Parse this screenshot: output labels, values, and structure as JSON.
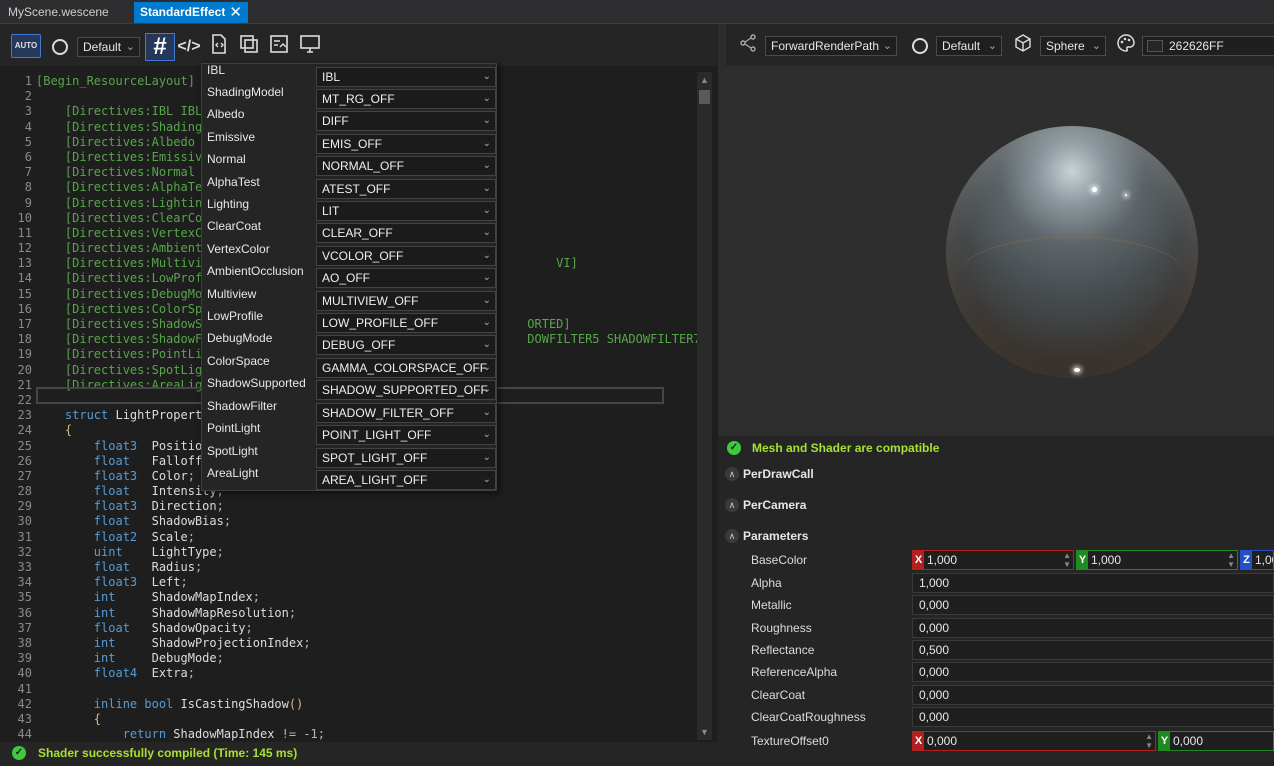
{
  "tabs": {
    "scene": "MyScene.wescene",
    "effect": "StandardEffect",
    "close_glyph": "✕"
  },
  "left_toolbar": {
    "auto_label": "AUTO",
    "profile_value": "Default"
  },
  "right_toolbar": {
    "render_path": "ForwardRenderPath",
    "environment": "Default",
    "mesh": "Sphere",
    "clear_color": "262626FF",
    "clear_color_hex": "#262626"
  },
  "directives": [
    {
      "label": "IBL",
      "value": "IBL"
    },
    {
      "label": "ShadingModel",
      "value": "MT_RG_OFF"
    },
    {
      "label": "Albedo",
      "value": "DIFF"
    },
    {
      "label": "Emissive",
      "value": "EMIS_OFF"
    },
    {
      "label": "Normal",
      "value": "NORMAL_OFF"
    },
    {
      "label": "AlphaTest",
      "value": "ATEST_OFF"
    },
    {
      "label": "Lighting",
      "value": "LIT"
    },
    {
      "label": "ClearCoat",
      "value": "CLEAR_OFF"
    },
    {
      "label": "VertexColor",
      "value": "VCOLOR_OFF"
    },
    {
      "label": "AmbientOcclusion",
      "value": "AO_OFF"
    },
    {
      "label": "Multiview",
      "value": "MULTIVIEW_OFF"
    },
    {
      "label": "LowProfile",
      "value": "LOW_PROFILE_OFF"
    },
    {
      "label": "DebugMode",
      "value": "DEBUG_OFF"
    },
    {
      "label": "ColorSpace",
      "value": "GAMMA_COLORSPACE_OFF"
    },
    {
      "label": "ShadowSupported",
      "value": "SHADOW_SUPPORTED_OFF"
    },
    {
      "label": "ShadowFilter",
      "value": "SHADOW_FILTER_OFF"
    },
    {
      "label": "PointLight",
      "value": "POINT_LIGHT_OFF"
    },
    {
      "label": "SpotLight",
      "value": "SPOT_LIGHT_OFF"
    },
    {
      "label": "AreaLight",
      "value": "AREA_LIGHT_OFF"
    }
  ],
  "code_lines": [
    {
      "n": "1",
      "s": [
        {
          "c": "g",
          "t": "[Begin_ResourceLayout]"
        }
      ]
    },
    {
      "n": "2",
      "s": []
    },
    {
      "n": "3",
      "s": [
        {
          "c": "g",
          "t": "    [Directives:IBL IBL"
        }
      ]
    },
    {
      "n": "4",
      "s": [
        {
          "c": "g",
          "t": "    [Directives:Shading"
        }
      ]
    },
    {
      "n": "5",
      "s": [
        {
          "c": "g",
          "t": "    [Directives:Albedo "
        }
      ]
    },
    {
      "n": "6",
      "s": [
        {
          "c": "g",
          "t": "    [Directives:Emissiv"
        }
      ]
    },
    {
      "n": "7",
      "s": [
        {
          "c": "g",
          "t": "    [Directives:Normal "
        }
      ]
    },
    {
      "n": "8",
      "s": [
        {
          "c": "g",
          "t": "    [Directives:AlphaTe"
        }
      ]
    },
    {
      "n": "9",
      "s": [
        {
          "c": "g",
          "t": "    [Directives:Lightin"
        }
      ]
    },
    {
      "n": "10",
      "s": [
        {
          "c": "g",
          "t": "    [Directives:ClearCo"
        }
      ]
    },
    {
      "n": "11",
      "s": [
        {
          "c": "g",
          "t": "    [Directives:VertexC"
        }
      ]
    },
    {
      "n": "12",
      "s": [
        {
          "c": "g",
          "t": "    [Directives:Ambient"
        }
      ]
    },
    {
      "n": "13",
      "s": [
        {
          "c": "g",
          "t": "    [Directives:Multivi                                                 VI]"
        }
      ]
    },
    {
      "n": "14",
      "s": [
        {
          "c": "g",
          "t": "    [Directives:LowProf"
        }
      ]
    },
    {
      "n": "15",
      "s": [
        {
          "c": "g",
          "t": "    [Directives:DebugMo"
        }
      ]
    },
    {
      "n": "16",
      "s": [
        {
          "c": "g",
          "t": "    [Directives:ColorSp"
        }
      ]
    },
    {
      "n": "17",
      "s": [
        {
          "c": "g",
          "t": "    [Directives:ShadowS                                             ORTED]"
        }
      ]
    },
    {
      "n": "18",
      "s": [
        {
          "c": "g",
          "t": "    [Directives:ShadowF                                             DOWFILTER5 SHADOWFILTER7]"
        }
      ]
    },
    {
      "n": "19",
      "s": [
        {
          "c": "g",
          "t": "    [Directives:PointLi"
        }
      ]
    },
    {
      "n": "20",
      "s": [
        {
          "c": "g",
          "t": "    [Directives:SpotLig"
        }
      ]
    },
    {
      "n": "21",
      "s": [
        {
          "c": "g",
          "t": "    [Directives:AreaLig"
        }
      ]
    },
    {
      "n": "22",
      "s": []
    },
    {
      "n": "23",
      "s": [
        {
          "c": "k",
          "t": "    struct "
        },
        {
          "c": "t",
          "t": "LightPropert"
        }
      ]
    },
    {
      "n": "24",
      "s": [
        {
          "c": "pu",
          "t": "    {"
        }
      ]
    },
    {
      "n": "25",
      "s": [
        {
          "c": "k",
          "t": "        float3  "
        },
        {
          "c": "t",
          "t": "Positio"
        }
      ]
    },
    {
      "n": "26",
      "s": [
        {
          "c": "k",
          "t": "        float   "
        },
        {
          "c": "t",
          "t": "Falloff"
        }
      ]
    },
    {
      "n": "27",
      "s": [
        {
          "c": "k",
          "t": "        float3  "
        },
        {
          "c": "t",
          "t": "Color"
        },
        {
          "c": "o",
          "t": ";"
        }
      ]
    },
    {
      "n": "28",
      "s": [
        {
          "c": "k",
          "t": "        float   "
        },
        {
          "c": "t",
          "t": "Intensity"
        },
        {
          "c": "o",
          "t": ";"
        }
      ]
    },
    {
      "n": "29",
      "s": [
        {
          "c": "k",
          "t": "        float3  "
        },
        {
          "c": "t",
          "t": "Direction"
        },
        {
          "c": "o",
          "t": ";"
        }
      ]
    },
    {
      "n": "30",
      "s": [
        {
          "c": "k",
          "t": "        float   "
        },
        {
          "c": "t",
          "t": "ShadowBias"
        },
        {
          "c": "o",
          "t": ";"
        }
      ]
    },
    {
      "n": "31",
      "s": [
        {
          "c": "k",
          "t": "        float2  "
        },
        {
          "c": "t",
          "t": "Scale"
        },
        {
          "c": "o",
          "t": ";"
        }
      ]
    },
    {
      "n": "32",
      "s": [
        {
          "c": "k",
          "t": "        uint    "
        },
        {
          "c": "t",
          "t": "LightType"
        },
        {
          "c": "o",
          "t": ";"
        }
      ]
    },
    {
      "n": "33",
      "s": [
        {
          "c": "k",
          "t": "        float   "
        },
        {
          "c": "t",
          "t": "Radius"
        },
        {
          "c": "o",
          "t": ";"
        }
      ]
    },
    {
      "n": "34",
      "s": [
        {
          "c": "k",
          "t": "        float3  "
        },
        {
          "c": "t",
          "t": "Left"
        },
        {
          "c": "o",
          "t": ";"
        }
      ]
    },
    {
      "n": "35",
      "s": [
        {
          "c": "k",
          "t": "        int     "
        },
        {
          "c": "t",
          "t": "ShadowMapIndex"
        },
        {
          "c": "o",
          "t": ";"
        }
      ]
    },
    {
      "n": "36",
      "s": [
        {
          "c": "k",
          "t": "        int     "
        },
        {
          "c": "t",
          "t": "ShadowMapResolution"
        },
        {
          "c": "o",
          "t": ";"
        }
      ]
    },
    {
      "n": "37",
      "s": [
        {
          "c": "k",
          "t": "        float   "
        },
        {
          "c": "t",
          "t": "ShadowOpacity"
        },
        {
          "c": "o",
          "t": ";"
        }
      ]
    },
    {
      "n": "38",
      "s": [
        {
          "c": "k",
          "t": "        int     "
        },
        {
          "c": "t",
          "t": "ShadowProjectionIndex"
        },
        {
          "c": "o",
          "t": ";"
        }
      ]
    },
    {
      "n": "39",
      "s": [
        {
          "c": "k",
          "t": "        int     "
        },
        {
          "c": "t",
          "t": "DebugMode"
        },
        {
          "c": "o",
          "t": ";"
        }
      ]
    },
    {
      "n": "40",
      "s": [
        {
          "c": "k",
          "t": "        float4  "
        },
        {
          "c": "t",
          "t": "Extra"
        },
        {
          "c": "o",
          "t": ";"
        }
      ]
    },
    {
      "n": "41",
      "s": []
    },
    {
      "n": "42",
      "s": [
        {
          "c": "k",
          "t": "        inline bool "
        },
        {
          "c": "t",
          "t": "IsCastingShadow"
        },
        {
          "c": "pu",
          "t": "()"
        }
      ]
    },
    {
      "n": "43",
      "s": [
        {
          "c": "pu",
          "t": "        {"
        }
      ]
    },
    {
      "n": "44",
      "s": [
        {
          "c": "k",
          "t": "            return "
        },
        {
          "c": "t",
          "t": "ShadowMapIndex "
        },
        {
          "c": "o",
          "t": "!= -1;"
        }
      ]
    }
  ],
  "status": {
    "compile": "Shader successfully compiled (Time: 145 ms)",
    "compatible": "Mesh and Shader are compatible"
  },
  "sections": {
    "per_draw": "PerDrawCall",
    "per_camera": "PerCamera",
    "parameters": "Parameters"
  },
  "parameters": {
    "base_color": {
      "label": "BaseColor",
      "x": "1,000",
      "y": "1,000",
      "z": "1,00"
    },
    "scalars": [
      {
        "label": "Alpha",
        "value": "1,000"
      },
      {
        "label": "Metallic",
        "value": "0,000"
      },
      {
        "label": "Roughness",
        "value": "0,000"
      },
      {
        "label": "Reflectance",
        "value": "0,500"
      },
      {
        "label": "ReferenceAlpha",
        "value": "0,000"
      },
      {
        "label": "ClearCoat",
        "value": "0,000"
      },
      {
        "label": "ClearCoatRoughness",
        "value": "0,000"
      }
    ],
    "texture_offset": {
      "label": "TextureOffset0",
      "x": "0,000",
      "y": "0,000"
    }
  },
  "axis_letters": {
    "x": "X",
    "y": "Y",
    "z": "Z"
  }
}
